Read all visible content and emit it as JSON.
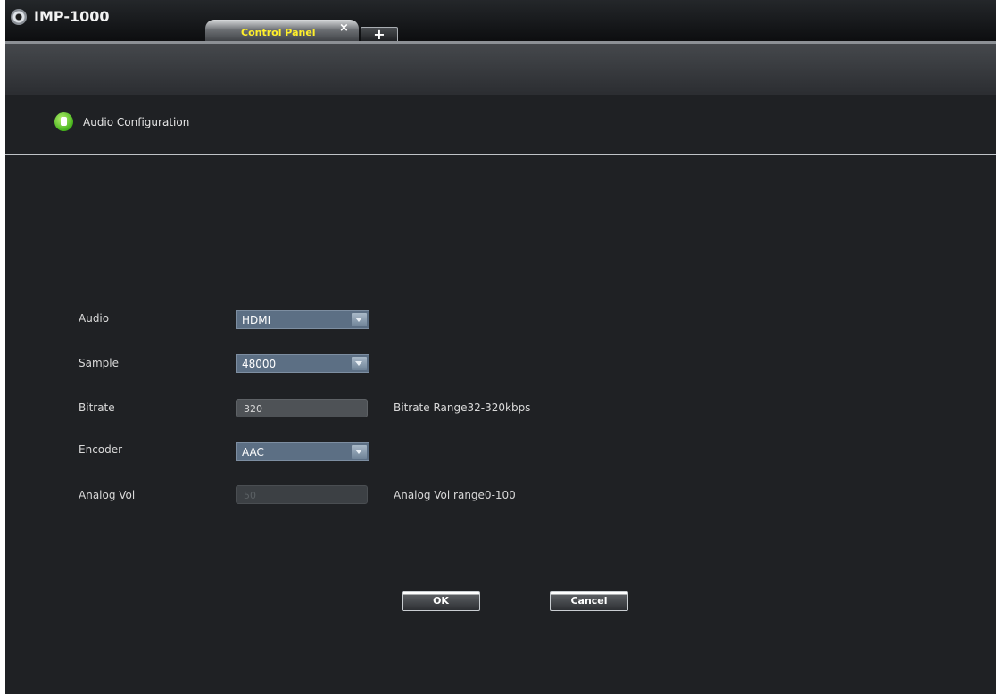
{
  "app": {
    "title": "IMP-1000"
  },
  "tabs": [
    {
      "label": "Control Panel",
      "close": "×"
    }
  ],
  "add_tab": "+",
  "section": {
    "title": "Audio Configuration"
  },
  "form": {
    "audio": {
      "label": "Audio",
      "value": "HDMI"
    },
    "sample": {
      "label": "Sample",
      "value": "48000"
    },
    "bitrate": {
      "label": "Bitrate",
      "value": "320",
      "hint": "Bitrate Range32-320kbps"
    },
    "encoder": {
      "label": "Encoder",
      "value": "AAC"
    },
    "analog_vol": {
      "label": "Analog Vol",
      "value": "50",
      "hint": "Analog Vol range0-100"
    }
  },
  "buttons": {
    "ok": "OK",
    "cancel": "Cancel"
  },
  "colors": {
    "tab_text": "#ffef2a",
    "section_icon": "#46b31c"
  }
}
